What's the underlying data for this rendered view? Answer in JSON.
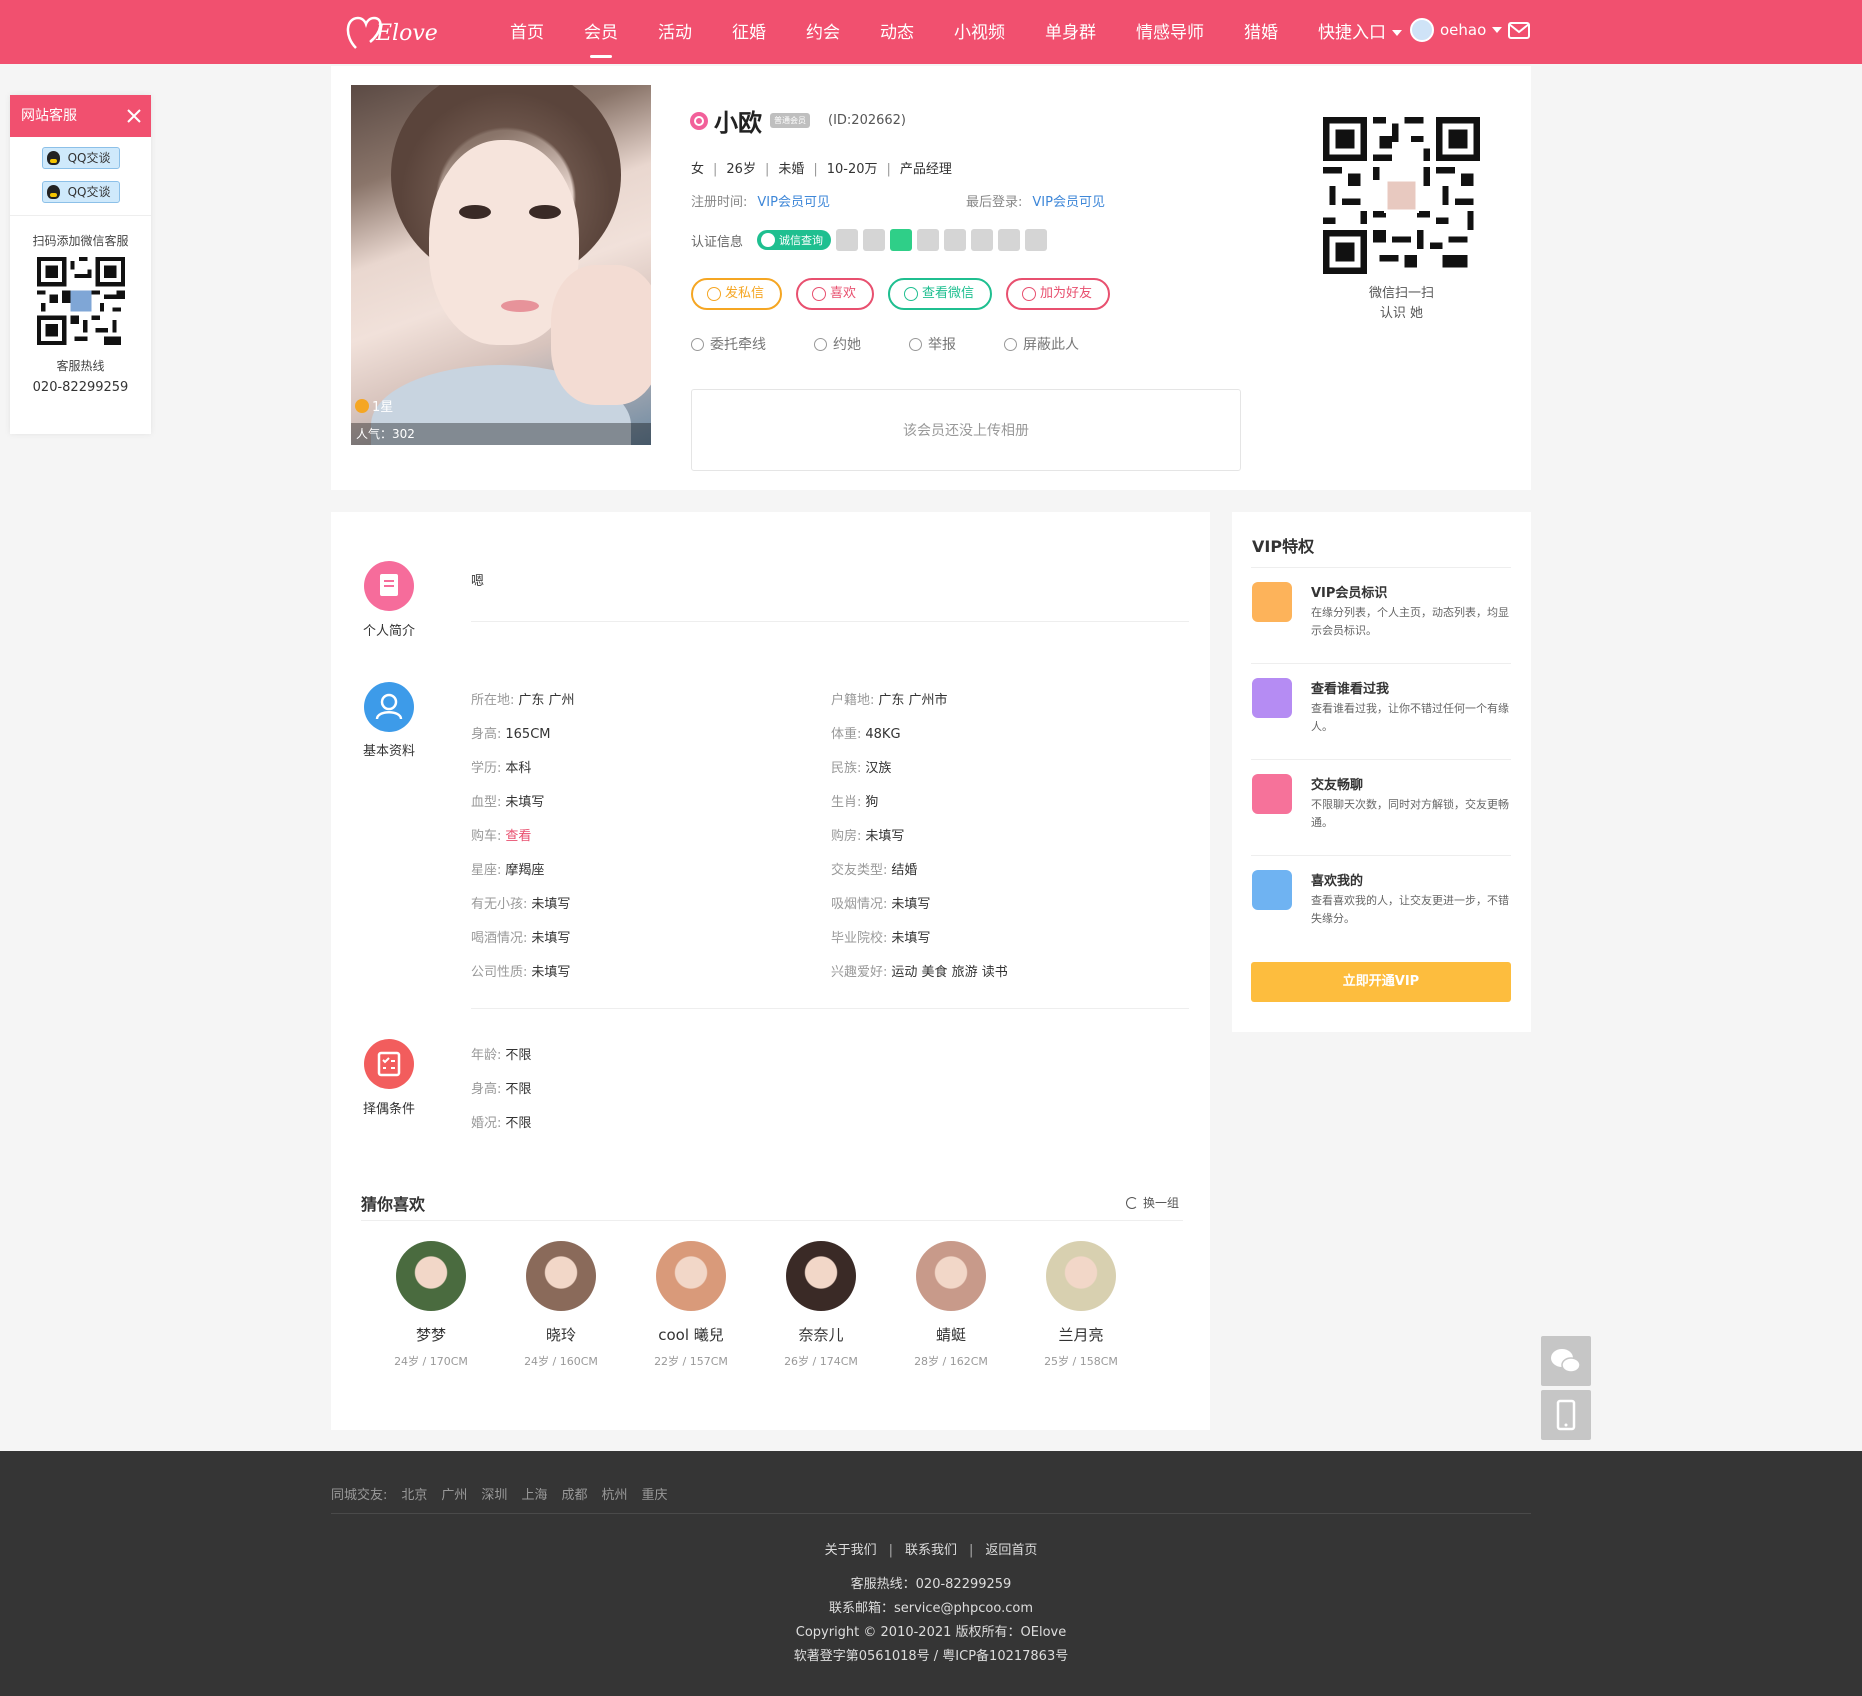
{
  "brand": {
    "logo": "Elove"
  },
  "nav": {
    "items": [
      "首页",
      "会员",
      "活动",
      "征婚",
      "约会",
      "动态",
      "小视频",
      "单身群",
      "情感导师",
      "猎婚",
      "快捷入口"
    ],
    "active_index": 1,
    "username": "oehao"
  },
  "service": {
    "title": "网站客服",
    "qq_buttons": [
      "QQ交谈",
      "QQ交谈"
    ],
    "wechat_caption": "扫码添加微信客服",
    "hotline_label": "客服热线",
    "hotline": "020-82299259"
  },
  "profile": {
    "star": "1星",
    "popularity": "人气：302",
    "name": "小欧",
    "member_badge": "普通会员",
    "id": "(ID:202662)",
    "gender": "女",
    "age": "26岁",
    "marital": "未婚",
    "income": "10-20万",
    "job": "产品经理",
    "register_label": "注册时间:",
    "register_value": "VIP会员可见",
    "last_login_label": "最后登录:",
    "last_login_value": "VIP会员可见",
    "cert_label": "认证信息",
    "cert_badge": "诚信查询",
    "actions": [
      "发私信",
      "喜欢",
      "查看微信",
      "加为好友"
    ],
    "links": [
      "委托牵线",
      "约她",
      "举报",
      "屏蔽此人"
    ],
    "album_empty": "该会员还没上传相册",
    "qr_caption_1": "微信扫一扫",
    "qr_caption_2": "认识 她"
  },
  "colors": {
    "brand": "#f1506f",
    "vip_button": "#fdbd3e",
    "orange": "#f5a623",
    "pink": "#e8506f",
    "green": "#1fbf90",
    "red": "#e8506f"
  },
  "intro": {
    "label": "个人简介",
    "text": "嗯"
  },
  "basic": {
    "label": "基本资料",
    "left": [
      {
        "k": "所在地:",
        "v": "广东 广州"
      },
      {
        "k": "身高:",
        "v": "165CM"
      },
      {
        "k": "学历:",
        "v": "本科"
      },
      {
        "k": "血型:",
        "v": "未填写"
      },
      {
        "k": "购车:",
        "v": "查看"
      },
      {
        "k": "星座:",
        "v": "摩羯座"
      },
      {
        "k": "有无小孩:",
        "v": "未填写"
      },
      {
        "k": "喝酒情况:",
        "v": "未填写"
      },
      {
        "k": "公司性质:",
        "v": "未填写"
      }
    ],
    "right": [
      {
        "k": "户籍地:",
        "v": "广东 广州市"
      },
      {
        "k": "体重:",
        "v": "48KG"
      },
      {
        "k": "民族:",
        "v": "汉族"
      },
      {
        "k": "生肖:",
        "v": "狗"
      },
      {
        "k": "购房:",
        "v": "未填写"
      },
      {
        "k": "交友类型:",
        "v": "结婚"
      },
      {
        "k": "吸烟情况:",
        "v": "未填写"
      },
      {
        "k": "毕业院校:",
        "v": "未填写"
      },
      {
        "k": "兴趣爱好:",
        "v": "运动  美食  旅游  读书"
      }
    ]
  },
  "mate": {
    "label": "择偶条件",
    "rows": [
      {
        "k": "年龄:",
        "v": "不限"
      },
      {
        "k": "身高:",
        "v": "不限"
      },
      {
        "k": "婚况:",
        "v": "不限"
      }
    ]
  },
  "guess": {
    "title": "猜你喜欢",
    "refresh": "换一组",
    "people": [
      {
        "name": "梦梦",
        "sub": "24岁 / 170CM"
      },
      {
        "name": "晓玲",
        "sub": "24岁 / 160CM"
      },
      {
        "name": "cool 曦兒",
        "sub": "22岁 / 157CM"
      },
      {
        "name": "奈奈儿",
        "sub": "26岁 / 174CM"
      },
      {
        "name": "蜻蜓",
        "sub": "28岁 / 162CM"
      },
      {
        "name": "兰月亮",
        "sub": "25岁 / 158CM"
      }
    ]
  },
  "vip": {
    "title": "VIP特权",
    "items": [
      {
        "name": "VIP会员标识",
        "desc": "在缘分列表，个人主页，动态列表，均显示会员标识。"
      },
      {
        "name": "查看谁看过我",
        "desc": "查看谁看过我，让你不错过任何一个有缘人。"
      },
      {
        "name": "交友畅聊",
        "desc": "不限聊天次数，同时对方解锁，交友更畅通。"
      },
      {
        "name": "喜欢我的",
        "desc": "查看喜欢我的人，让交友更进一步，不错失缘分。"
      }
    ],
    "button": "立即开通VIP"
  },
  "footer": {
    "city_label": "同城交友:",
    "cities": [
      "北京",
      "广州",
      "深圳",
      "上海",
      "成都",
      "杭州",
      "重庆"
    ],
    "links": [
      "关于我们",
      "联系我们",
      "返回首页"
    ],
    "hotline": "客服热线：020-82299259",
    "email": "联系邮箱：service@phpcoo.com",
    "copyright": "Copyright © 2010-2021    版权所有：OElove",
    "icp": "软著登字第0561018号 / 粤ICP备10217863号"
  }
}
